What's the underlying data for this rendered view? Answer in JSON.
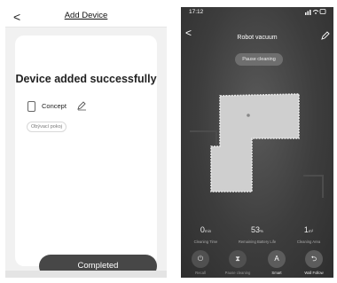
{
  "left": {
    "header": {
      "back_glyph": "<",
      "title": "Add Device"
    },
    "success_message": "Device added successfully",
    "device": {
      "name": "Concept",
      "icon": "phone-device-icon",
      "edit_icon": "pencil-icon"
    },
    "room_chip": "Obývací pokoj",
    "completed_button": "Completed"
  },
  "right": {
    "status": {
      "time": "17:12",
      "icons": "wifi-icon battery-icon"
    },
    "header": {
      "back_glyph": "<",
      "title": "Robot vacuum",
      "edit_icon": "pencil-icon"
    },
    "pause_button": "Pause cleaning",
    "stats": [
      {
        "value": "0",
        "unit": "min",
        "label": "Cleaning Time"
      },
      {
        "value": "53",
        "unit": "%",
        "label": "Remaining Battery Life"
      },
      {
        "value": "1",
        "unit": "m²",
        "label": "Cleaning Area"
      }
    ],
    "controls": [
      {
        "label": "Recall",
        "icon": "power-icon",
        "glyph": "⏻",
        "active": false
      },
      {
        "label": "Pause cleaning",
        "icon": "hourglass-icon",
        "glyph": "⧗",
        "active": false
      },
      {
        "label": "Smart",
        "icon": "smart-a-icon",
        "glyph": "A",
        "active": true
      },
      {
        "label": "Wall Follow",
        "icon": "wall-follow-icon",
        "glyph": "⮌",
        "active": true
      }
    ]
  }
}
